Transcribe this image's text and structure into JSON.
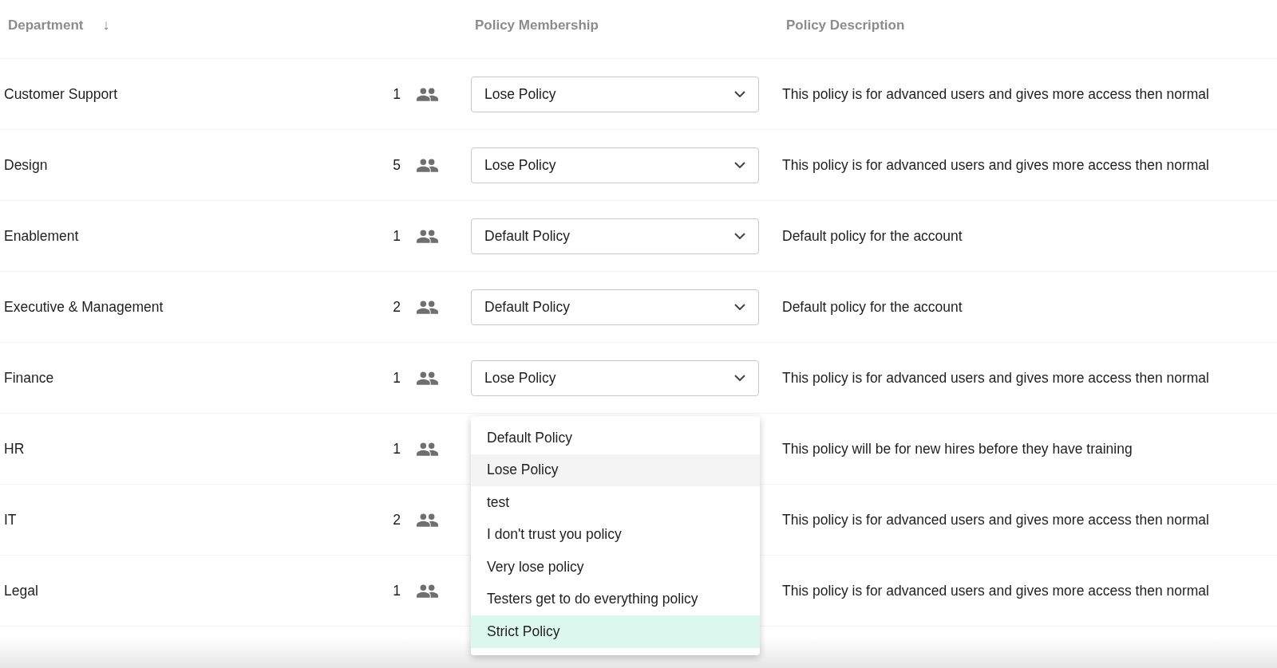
{
  "columns": [
    {
      "label": "Department",
      "sort_arrow": "↓"
    },
    {
      "label": "Policy Membership"
    },
    {
      "label": "Policy Description"
    }
  ],
  "rows": [
    {
      "department": "Customer Support",
      "members": "1",
      "policy": "Lose Policy",
      "description": "This policy is for advanced users and gives more access then normal"
    },
    {
      "department": "Design",
      "members": "5",
      "policy": "Lose Policy",
      "description": "This policy is for advanced users and gives more access then normal"
    },
    {
      "department": "Enablement",
      "members": "1",
      "policy": "Default Policy",
      "description": "Default policy for the account"
    },
    {
      "department": "Executive & Management",
      "members": "2",
      "policy": "Default Policy",
      "description": "Default policy for the account"
    },
    {
      "department": "Finance",
      "members": "1",
      "policy": "Lose Policy",
      "description": "This policy is for advanced users and gives more access then normal",
      "expanded": true
    },
    {
      "department": "HR",
      "members": "1",
      "description": "This policy will be for new hires before they have training"
    },
    {
      "department": "IT",
      "members": "2",
      "description": "This policy is for advanced users and gives more access then normal"
    },
    {
      "department": "Legal",
      "members": "1",
      "description": "This policy is for advanced users and gives more access then normal"
    }
  ],
  "dropdown": {
    "options": [
      {
        "label": "Default Policy",
        "selected": false,
        "highlighted": false
      },
      {
        "label": "Lose Policy",
        "selected": true,
        "highlighted": false
      },
      {
        "label": "test",
        "selected": false,
        "highlighted": false
      },
      {
        "label": "I don't trust you policy",
        "selected": false,
        "highlighted": false
      },
      {
        "label": "Very lose policy",
        "selected": false,
        "highlighted": false
      },
      {
        "label": "Testers get to do everything policy",
        "selected": false,
        "highlighted": false
      },
      {
        "label": "Strict Policy",
        "selected": false,
        "highlighted": true
      }
    ]
  }
}
